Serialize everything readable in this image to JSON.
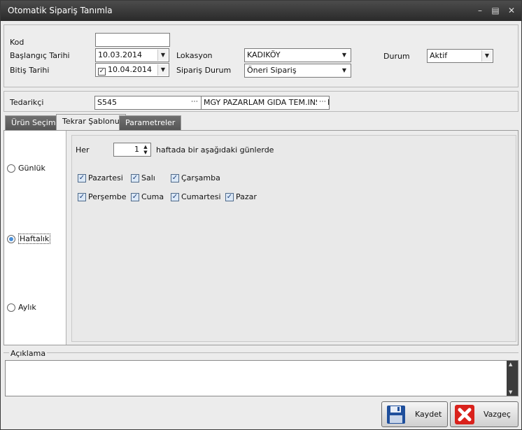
{
  "window": {
    "title": "Otomatik Sipariş Tanımla"
  },
  "header": {
    "kod": {
      "label": "Kod",
      "value": ""
    },
    "start_date": {
      "label": "Başlangıç Tarihi",
      "value": "10.03.2014"
    },
    "end_date": {
      "label": "Bitiş Tarihi",
      "value": "10.04.2014",
      "checked": true
    },
    "location": {
      "label": "Lokasyon",
      "value": "KADIKÖY"
    },
    "order_status": {
      "label": "Sipariş Durum",
      "value": "Öneri Sipariş"
    },
    "status": {
      "label": "Durum",
      "value": "Aktif"
    }
  },
  "supplier": {
    "label": "Tedarikçi",
    "code": "S545",
    "name": "MGY PAZARLAM GIDA TEM.INS.LT"
  },
  "tabs": [
    {
      "label": "Ürün Seçimi",
      "active": false
    },
    {
      "label": "Tekrar Şablonu",
      "active": true
    },
    {
      "label": "Parametreler",
      "active": false
    }
  ],
  "frequency": {
    "daily": "Günlük",
    "weekly": "Haftalık",
    "monthly": "Aylık",
    "selected": "weekly"
  },
  "weekly": {
    "every_label": "Her",
    "interval": "1",
    "suffix": "haftada bir aşağıdaki günlerde",
    "days": [
      {
        "label": "Pazartesi",
        "checked": true
      },
      {
        "label": "Salı",
        "checked": true
      },
      {
        "label": "Çarşamba",
        "checked": true
      },
      {
        "label": "Perşembe",
        "checked": true
      },
      {
        "label": "Cuma",
        "checked": true
      },
      {
        "label": "Cumartesi",
        "checked": true
      },
      {
        "label": "Pazar",
        "checked": true
      }
    ]
  },
  "description": {
    "label": "Açıklama",
    "value": ""
  },
  "buttons": {
    "save": "Kaydet",
    "cancel": "Vazgeç"
  },
  "colors": {
    "accent": "#4a90d9",
    "titlebar": "#2f2f2f",
    "cancel_red": "#d9221c",
    "save_blue": "#1f4f9c"
  },
  "icons": {
    "save": "floppy-disk-icon",
    "cancel": "red-x-icon",
    "minimize": "minimize-icon",
    "maximize": "maximize-icon",
    "close": "close-icon"
  }
}
